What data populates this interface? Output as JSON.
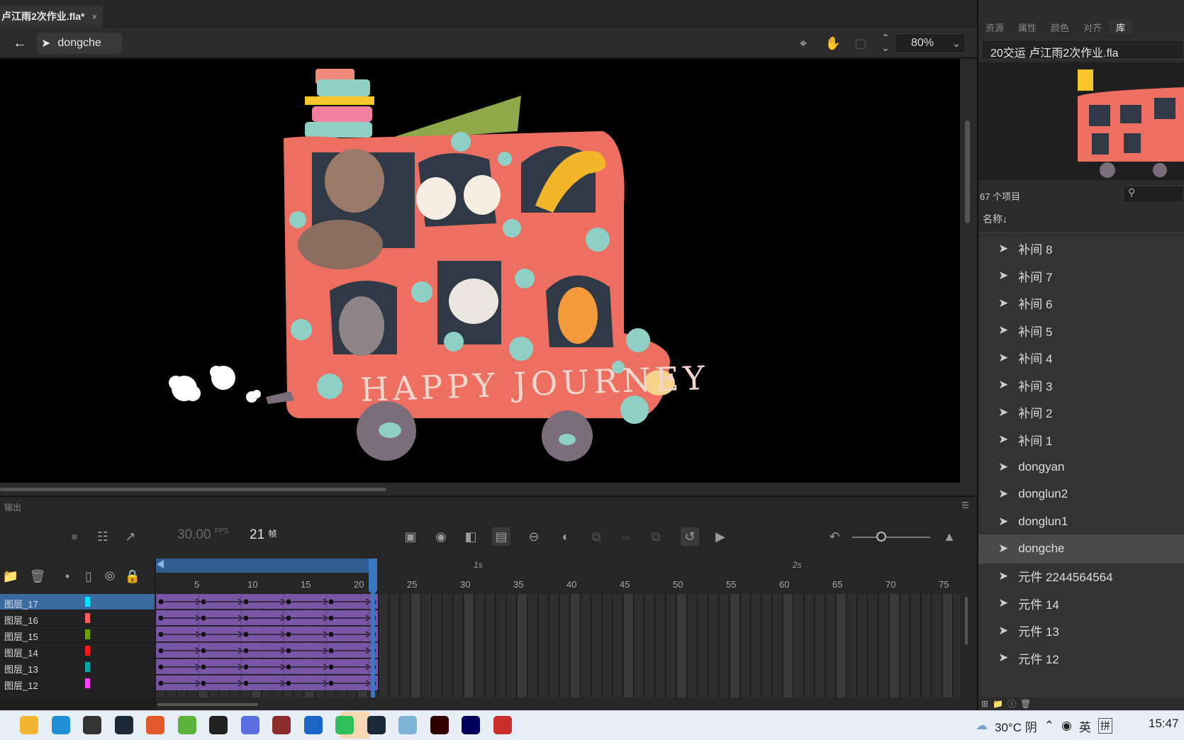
{
  "document_tab": {
    "title": "卢江雨2次作业.fla*",
    "close": "×"
  },
  "edit_bar": {
    "symbol_name": "dongche",
    "zoom": "80%"
  },
  "output_panel": {
    "title": "输出"
  },
  "timeline": {
    "fps_value": "30.00",
    "fps_unit": "FPS",
    "current_frame": "21",
    "frame_unit": "帧",
    "ruler_numbers": [
      "5",
      "10",
      "15",
      "20",
      "25",
      "30",
      "35",
      "40",
      "45",
      "50",
      "55",
      "60",
      "65",
      "70",
      "75"
    ],
    "seconds_markers": [
      "1s",
      "2s"
    ],
    "layers": [
      {
        "name": "图层_17",
        "color": "#00e5ff",
        "selected": true
      },
      {
        "name": "图层_16",
        "color": "#ff5a5a",
        "selected": false
      },
      {
        "name": "图层_15",
        "color": "#6aa000",
        "selected": false
      },
      {
        "name": "图层_14",
        "color": "#ff1a1a",
        "selected": false
      },
      {
        "name": "图层_13",
        "color": "#00a8a8",
        "selected": false
      },
      {
        "name": "图层_12",
        "color": "#ff40ff",
        "selected": false
      }
    ]
  },
  "library": {
    "tabs": [
      "资源",
      "属性",
      "颜色",
      "对齐",
      "库"
    ],
    "active_tab": "库",
    "file_name": "20交运 卢江雨2次作业.fla",
    "item_count": "67 个项目",
    "column_name": "名称↓",
    "items": [
      {
        "name": "补间 8",
        "selected": false
      },
      {
        "name": "补间 7",
        "selected": false
      },
      {
        "name": "补间 6",
        "selected": false
      },
      {
        "name": "补间 5",
        "selected": false
      },
      {
        "name": "补间 4",
        "selected": false
      },
      {
        "name": "补间 3",
        "selected": false
      },
      {
        "name": "补间 2",
        "selected": false
      },
      {
        "name": "补间 1",
        "selected": false
      },
      {
        "name": "dongyan",
        "selected": false
      },
      {
        "name": "donglun2",
        "selected": false
      },
      {
        "name": "donglun1",
        "selected": false
      },
      {
        "name": "dongche",
        "selected": true
      },
      {
        "name": "元件 2244564564",
        "selected": false
      },
      {
        "name": "元件 14",
        "selected": false
      },
      {
        "name": "元件 13",
        "selected": false
      },
      {
        "name": "元件 12",
        "selected": false
      }
    ]
  },
  "stage_art": {
    "bus_text": "HAPPY JOURNEY",
    "bus_color": "#ec6f62"
  },
  "taskbar": {
    "weather": "30°C 阴",
    "ime_lang": "英",
    "ime_mode": "拼",
    "clock": "15:47",
    "apps": [
      "file-explorer",
      "edge",
      "epic-games",
      "steam",
      "maps",
      "ie",
      "obs",
      "photos",
      "winrar",
      "pdf",
      "wechat",
      "steam-2",
      "notepad",
      "illustrator",
      "animate",
      "recorder"
    ]
  },
  "colors": {
    "accent_blue": "#3b78c2",
    "tween_purple": "#7a56a6",
    "selection_blue": "#3b6aa0"
  }
}
